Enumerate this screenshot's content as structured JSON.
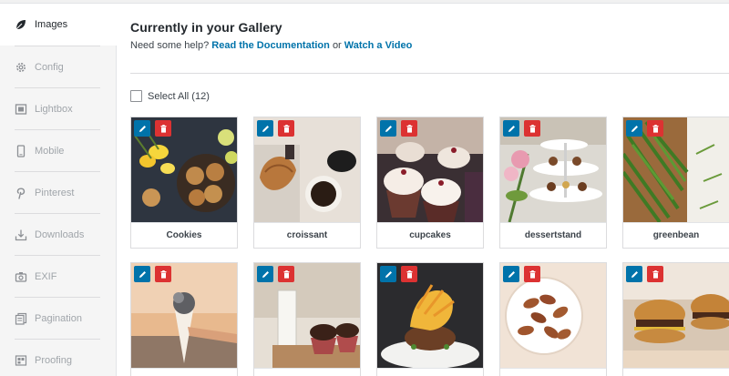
{
  "sidebar": {
    "items": [
      {
        "label": "Images",
        "icon": "leaf-icon",
        "active": true
      },
      {
        "label": "Config",
        "icon": "gear-icon"
      },
      {
        "label": "Lightbox",
        "icon": "lightbox-icon"
      },
      {
        "label": "Mobile",
        "icon": "mobile-icon"
      },
      {
        "label": "Pinterest",
        "icon": "pinterest-icon"
      },
      {
        "label": "Downloads",
        "icon": "download-icon"
      },
      {
        "label": "EXIF",
        "icon": "camera-icon"
      },
      {
        "label": "Pagination",
        "icon": "pagination-icon"
      },
      {
        "label": "Proofing",
        "icon": "proofing-icon"
      }
    ]
  },
  "main": {
    "title": "Currently in your Gallery",
    "help_prefix": "Need some help?",
    "help_link1": "Read the Documentation",
    "help_or": "or",
    "help_link2": "Watch a Video",
    "select_all": "Select All (12)"
  },
  "images": [
    {
      "caption": "Cookies"
    },
    {
      "caption": "croissant"
    },
    {
      "caption": "cupcakes"
    },
    {
      "caption": "dessertstand"
    },
    {
      "caption": "greenbean"
    },
    {
      "caption": ""
    },
    {
      "caption": ""
    },
    {
      "caption": ""
    },
    {
      "caption": ""
    },
    {
      "caption": ""
    }
  ],
  "colors": {
    "accent_link": "#0073aa",
    "edit_button": "#0073aa",
    "delete_button": "#dc3232"
  }
}
